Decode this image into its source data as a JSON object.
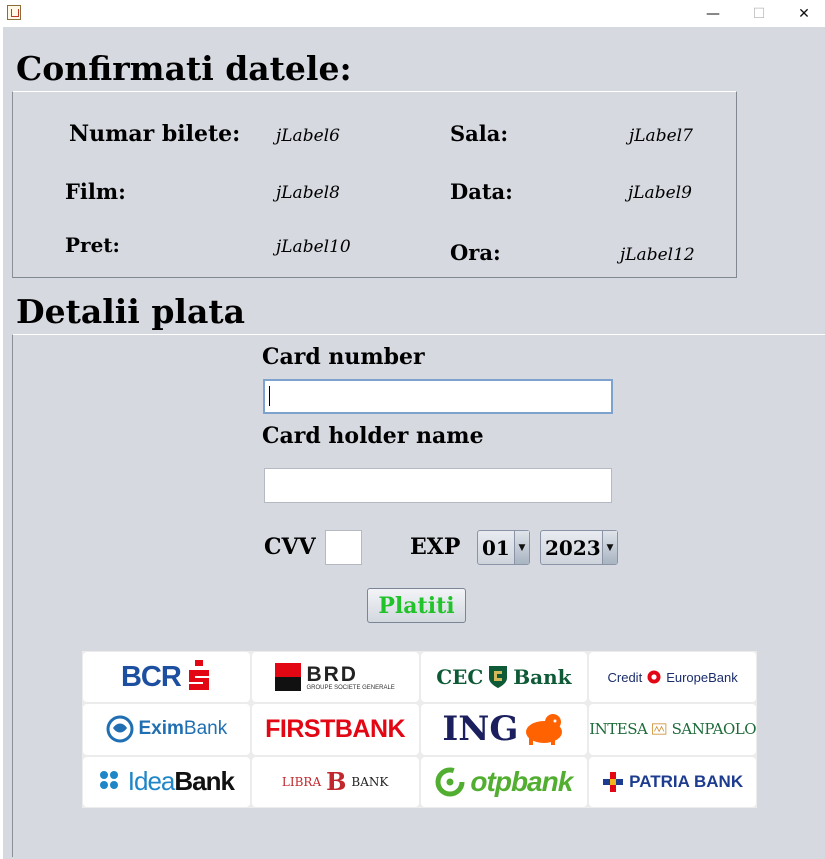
{
  "window": {
    "minimize": "—",
    "maximize": "☐",
    "close": "✕"
  },
  "confirm": {
    "title": "Confirmati datele:",
    "numar_label": "Numar bilete:",
    "numar_value": "jLabel6",
    "sala_label": "Sala:",
    "sala_value": "jLabel7",
    "film_label": "Film:",
    "film_value": "jLabel8",
    "data_label": "Data:",
    "data_value": "jLabel9",
    "pret_label": "Pret:",
    "pret_value": "jLabel10",
    "ora_label": "Ora:",
    "ora_value": "jLabel12"
  },
  "payment": {
    "title": "Detalii plata",
    "card_number_label": "Card number",
    "card_number_value": "",
    "card_holder_label": "Card holder name",
    "card_holder_value": "",
    "cvv_label": "CVV",
    "cvv_value": "",
    "exp_label": "EXP",
    "exp_month": "01",
    "exp_year": "2023",
    "pay_button": "Platiti",
    "pay_button_color": "#22c32a"
  },
  "banks": {
    "bcr": "BCR",
    "brd": "BRD",
    "brd_sub": "GROUPE SOCIETE GENERALE",
    "cec_a": "CEC",
    "cec_b": "Bank",
    "credit_a": "Credit",
    "credit_b": "EuropeBank",
    "exim_a": "Exim",
    "exim_b": "Bank",
    "first": "FIRSTBANK",
    "ing": "ING",
    "intesa_a": "INTESA",
    "intesa_b": "SANPAOLO",
    "idea_a": "Idea",
    "idea_b": "Bank",
    "libra_a": "LIBRA",
    "libra_b": "B",
    "libra_c": "BANK",
    "otp": "otpbank",
    "patria": "PATRIA BANK"
  },
  "colors": {
    "background": "#d6d9e0",
    "bcr_red": "#e30613",
    "bcr_blue": "#1d4fa1",
    "cec_green": "#0e5a36",
    "ing_orange": "#ff6200",
    "ing_navy": "#1b1f5e",
    "otp_green": "#52ae30"
  }
}
